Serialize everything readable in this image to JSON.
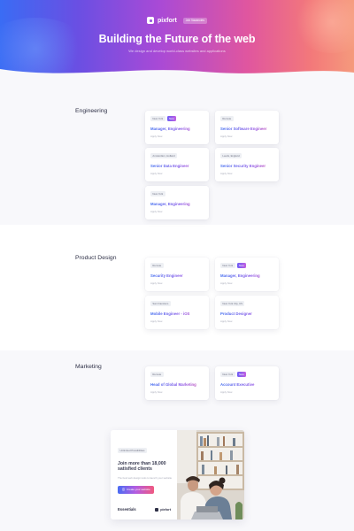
{
  "hero": {
    "brand_name": "pixfort",
    "brand_badge": "Job Vacancies",
    "title": "Building the Future of the web",
    "subtitle": "We design and develop world-class websites and applications"
  },
  "sections": [
    {
      "title": "Engineering",
      "jobs": [
        {
          "tags": [
            "New York"
          ],
          "new_badge": "New",
          "role": "Manager, Engineering",
          "apply": "Apply Now"
        },
        {
          "tags": [
            "Remote"
          ],
          "new_badge": "",
          "role": "Senior Software Engineer",
          "apply": "Apply Now"
        },
        {
          "tags": [
            "Amsterdam, Holland"
          ],
          "new_badge": "",
          "role": "Senior Data Engineer",
          "apply": "Apply Now"
        },
        {
          "tags": [
            "Leeds, England"
          ],
          "new_badge": "",
          "role": "Senior Security Engineer",
          "apply": "Apply Now"
        },
        {
          "tags": [
            "New York"
          ],
          "new_badge": "",
          "role": "Manager, Engineering",
          "apply": "Apply Now"
        }
      ]
    },
    {
      "title": "Product Design",
      "jobs": [
        {
          "tags": [
            "Remote"
          ],
          "new_badge": "",
          "role": "Security Engineer",
          "apply": "Apply Now"
        },
        {
          "tags": [
            "New York"
          ],
          "new_badge": "New",
          "role": "Manager, Engineering",
          "apply": "Apply Now"
        },
        {
          "tags": [
            "San Francisco"
          ],
          "new_badge": "",
          "role": "Mobile Engineer - iOS",
          "apply": "Apply Now"
        },
        {
          "tags": [
            "New York City, US"
          ],
          "new_badge": "",
          "role": "Product Designer",
          "apply": "Apply Now"
        }
      ]
    },
    {
      "title": "Marketing",
      "jobs": [
        {
          "tags": [
            "Remote"
          ],
          "new_badge": "",
          "role": "Head of Global Marketing",
          "apply": "Apply Now"
        },
        {
          "tags": [
            "New York"
          ],
          "new_badge": "New",
          "role": "Account Executive",
          "apply": "Apply Now"
        }
      ]
    }
  ],
  "promo": {
    "tag": "Unlimited Possibilities",
    "heading": "Join more than 18,000 satisfied clients",
    "description": "The best web design tools to launch your website",
    "button_label": "Create your website",
    "footer_title": "Essentials",
    "footer_brand": "pixfort"
  },
  "colors": {
    "accent_blue": "#3d6bf0",
    "accent_purple": "#8a52e6",
    "accent_pink": "#e24fa0",
    "hero_start": "#3a6cf4",
    "hero_end": "#f59a7c"
  },
  "icons": {
    "brand": "pixfort-logo-icon",
    "button": "plus-icon"
  }
}
